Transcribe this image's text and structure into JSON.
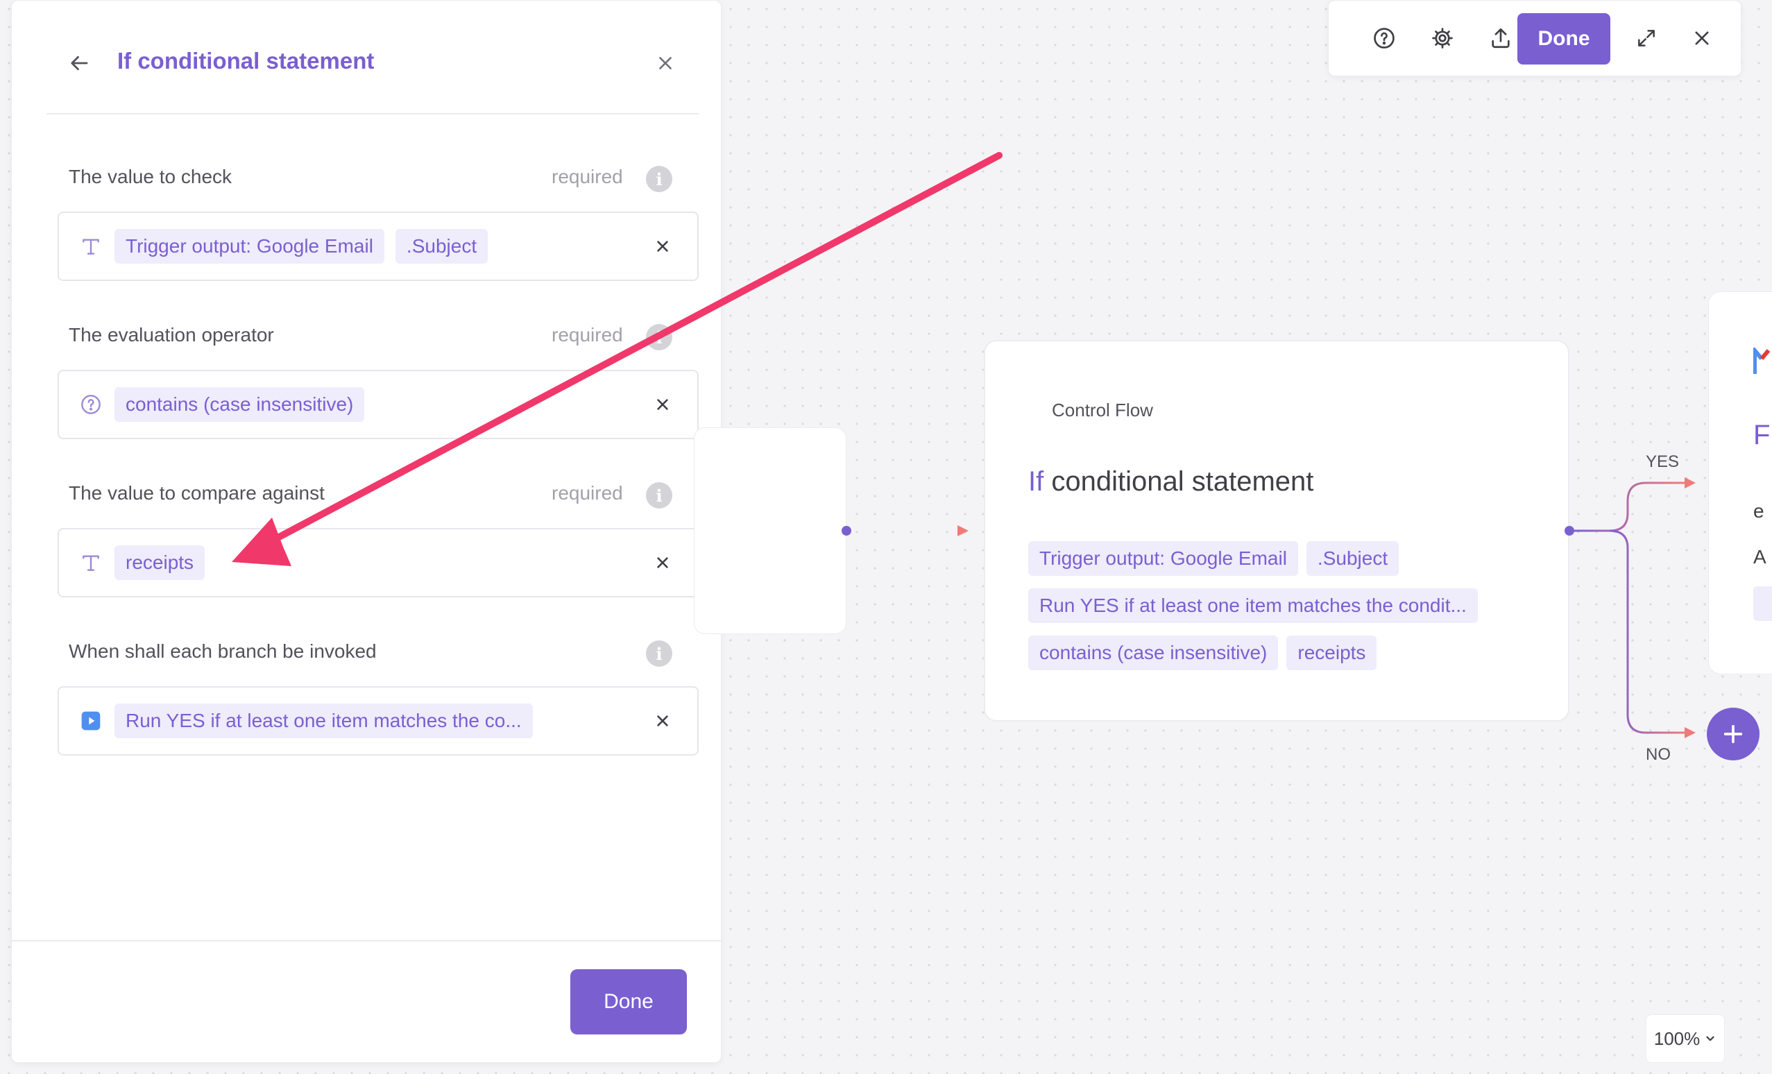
{
  "panel": {
    "title": "If conditional statement",
    "fields": [
      {
        "label": "The value to check",
        "required": "required",
        "chips": [
          "Trigger output: Google Email",
          ".Subject"
        ]
      },
      {
        "label": "The evaluation operator",
        "required": "required",
        "chips": [
          "contains (case insensitive)"
        ]
      },
      {
        "label": "The value to compare against",
        "required": "required",
        "chips": [
          "receipts"
        ]
      },
      {
        "label": "When shall each branch be invoked",
        "chips": [
          "Run YES if at least one item matches the co..."
        ]
      }
    ],
    "done_label": "Done"
  },
  "toolbar": {
    "done_label": "Done",
    "icons": [
      "help-icon",
      "gear-icon",
      "upload-icon",
      "expand-icon",
      "close-icon"
    ]
  },
  "node": {
    "category": "Control Flow",
    "title_keyword": "If",
    "title_rest": "conditional statement",
    "chip_rows": [
      [
        "Trigger output: Google Email",
        ".Subject"
      ],
      [
        "Run YES if at least one item matches the condit..."
      ],
      [
        "contains (case insensitive)",
        "receipts"
      ]
    ]
  },
  "right_node": {
    "title_fragment": "F",
    "line1": "e",
    "line2": "A"
  },
  "branches": {
    "yes": "YES",
    "no": "NO"
  },
  "zoom": {
    "level": "100%"
  },
  "colors": {
    "accent": "#7a5fd1",
    "chip_bg": "#efecfb",
    "arrow": "#f0386b",
    "connector": "#f07a7a"
  }
}
